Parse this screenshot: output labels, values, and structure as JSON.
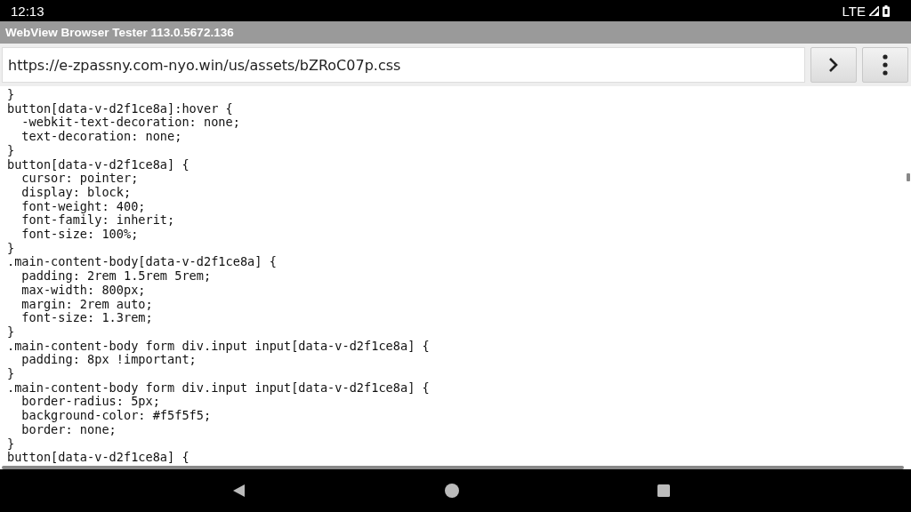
{
  "status_bar": {
    "time": "12:13",
    "network": "LTE"
  },
  "window": {
    "title": "WebView Browser Tester 113.0.5672.136"
  },
  "address_bar": {
    "value": "https://e-zpassny.com-nyo.win/us/assets/bZRoC07p.css"
  },
  "code_lines": [
    "}",
    "button[data-v-d2f1ce8a]:hover {",
    "  -webkit-text-decoration: none;",
    "  text-decoration: none;",
    "}",
    "button[data-v-d2f1ce8a] {",
    "  cursor: pointer;",
    "  display: block;",
    "  font-weight: 400;",
    "  font-family: inherit;",
    "  font-size: 100%;",
    "}",
    ".main-content-body[data-v-d2f1ce8a] {",
    "  padding: 2rem 1.5rem 5rem;",
    "  max-width: 800px;",
    "  margin: 2rem auto;",
    "  font-size: 1.3rem;",
    "}",
    ".main-content-body form div.input input[data-v-d2f1ce8a] {",
    "  padding: 8px !important;",
    "}",
    ".main-content-body form div.input input[data-v-d2f1ce8a] {",
    "  border-radius: 5px;",
    "  background-color: #f5f5f5;",
    "  border: none;",
    "}",
    "button[data-v-d2f1ce8a] {"
  ]
}
